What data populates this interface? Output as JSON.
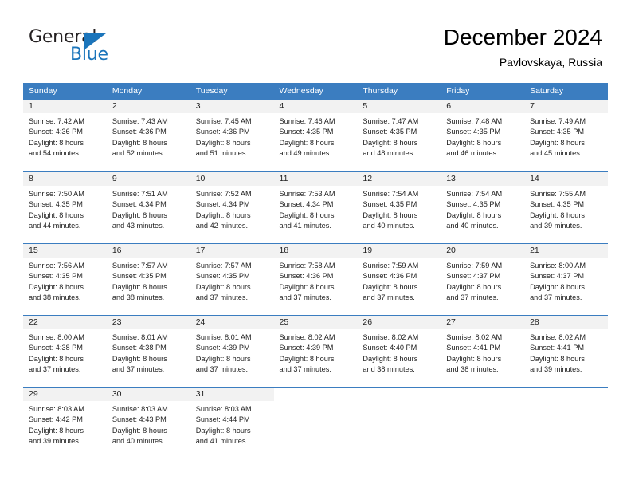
{
  "brand": {
    "name_part1": "General",
    "name_part2": "Blue",
    "accent_color": "#1b75bb",
    "triangle_icon": "triangle-icon"
  },
  "header": {
    "title": "December 2024",
    "subtitle": "Pavlovskaya, Russia"
  },
  "calendar": {
    "header_bg": "#3b7dc0",
    "daynum_strip_bg": "#f2f2f2",
    "weekdays": [
      "Sunday",
      "Monday",
      "Tuesday",
      "Wednesday",
      "Thursday",
      "Friday",
      "Saturday"
    ],
    "weeks": [
      [
        {
          "day": "1",
          "sunrise": "Sunrise: 7:42 AM",
          "sunset": "Sunset: 4:36 PM",
          "daylight_1": "Daylight: 8 hours",
          "daylight_2": "and 54 minutes."
        },
        {
          "day": "2",
          "sunrise": "Sunrise: 7:43 AM",
          "sunset": "Sunset: 4:36 PM",
          "daylight_1": "Daylight: 8 hours",
          "daylight_2": "and 52 minutes."
        },
        {
          "day": "3",
          "sunrise": "Sunrise: 7:45 AM",
          "sunset": "Sunset: 4:36 PM",
          "daylight_1": "Daylight: 8 hours",
          "daylight_2": "and 51 minutes."
        },
        {
          "day": "4",
          "sunrise": "Sunrise: 7:46 AM",
          "sunset": "Sunset: 4:35 PM",
          "daylight_1": "Daylight: 8 hours",
          "daylight_2": "and 49 minutes."
        },
        {
          "day": "5",
          "sunrise": "Sunrise: 7:47 AM",
          "sunset": "Sunset: 4:35 PM",
          "daylight_1": "Daylight: 8 hours",
          "daylight_2": "and 48 minutes."
        },
        {
          "day": "6",
          "sunrise": "Sunrise: 7:48 AM",
          "sunset": "Sunset: 4:35 PM",
          "daylight_1": "Daylight: 8 hours",
          "daylight_2": "and 46 minutes."
        },
        {
          "day": "7",
          "sunrise": "Sunrise: 7:49 AM",
          "sunset": "Sunset: 4:35 PM",
          "daylight_1": "Daylight: 8 hours",
          "daylight_2": "and 45 minutes."
        }
      ],
      [
        {
          "day": "8",
          "sunrise": "Sunrise: 7:50 AM",
          "sunset": "Sunset: 4:35 PM",
          "daylight_1": "Daylight: 8 hours",
          "daylight_2": "and 44 minutes."
        },
        {
          "day": "9",
          "sunrise": "Sunrise: 7:51 AM",
          "sunset": "Sunset: 4:34 PM",
          "daylight_1": "Daylight: 8 hours",
          "daylight_2": "and 43 minutes."
        },
        {
          "day": "10",
          "sunrise": "Sunrise: 7:52 AM",
          "sunset": "Sunset: 4:34 PM",
          "daylight_1": "Daylight: 8 hours",
          "daylight_2": "and 42 minutes."
        },
        {
          "day": "11",
          "sunrise": "Sunrise: 7:53 AM",
          "sunset": "Sunset: 4:34 PM",
          "daylight_1": "Daylight: 8 hours",
          "daylight_2": "and 41 minutes."
        },
        {
          "day": "12",
          "sunrise": "Sunrise: 7:54 AM",
          "sunset": "Sunset: 4:35 PM",
          "daylight_1": "Daylight: 8 hours",
          "daylight_2": "and 40 minutes."
        },
        {
          "day": "13",
          "sunrise": "Sunrise: 7:54 AM",
          "sunset": "Sunset: 4:35 PM",
          "daylight_1": "Daylight: 8 hours",
          "daylight_2": "and 40 minutes."
        },
        {
          "day": "14",
          "sunrise": "Sunrise: 7:55 AM",
          "sunset": "Sunset: 4:35 PM",
          "daylight_1": "Daylight: 8 hours",
          "daylight_2": "and 39 minutes."
        }
      ],
      [
        {
          "day": "15",
          "sunrise": "Sunrise: 7:56 AM",
          "sunset": "Sunset: 4:35 PM",
          "daylight_1": "Daylight: 8 hours",
          "daylight_2": "and 38 minutes."
        },
        {
          "day": "16",
          "sunrise": "Sunrise: 7:57 AM",
          "sunset": "Sunset: 4:35 PM",
          "daylight_1": "Daylight: 8 hours",
          "daylight_2": "and 38 minutes."
        },
        {
          "day": "17",
          "sunrise": "Sunrise: 7:57 AM",
          "sunset": "Sunset: 4:35 PM",
          "daylight_1": "Daylight: 8 hours",
          "daylight_2": "and 37 minutes."
        },
        {
          "day": "18",
          "sunrise": "Sunrise: 7:58 AM",
          "sunset": "Sunset: 4:36 PM",
          "daylight_1": "Daylight: 8 hours",
          "daylight_2": "and 37 minutes."
        },
        {
          "day": "19",
          "sunrise": "Sunrise: 7:59 AM",
          "sunset": "Sunset: 4:36 PM",
          "daylight_1": "Daylight: 8 hours",
          "daylight_2": "and 37 minutes."
        },
        {
          "day": "20",
          "sunrise": "Sunrise: 7:59 AM",
          "sunset": "Sunset: 4:37 PM",
          "daylight_1": "Daylight: 8 hours",
          "daylight_2": "and 37 minutes."
        },
        {
          "day": "21",
          "sunrise": "Sunrise: 8:00 AM",
          "sunset": "Sunset: 4:37 PM",
          "daylight_1": "Daylight: 8 hours",
          "daylight_2": "and 37 minutes."
        }
      ],
      [
        {
          "day": "22",
          "sunrise": "Sunrise: 8:00 AM",
          "sunset": "Sunset: 4:38 PM",
          "daylight_1": "Daylight: 8 hours",
          "daylight_2": "and 37 minutes."
        },
        {
          "day": "23",
          "sunrise": "Sunrise: 8:01 AM",
          "sunset": "Sunset: 4:38 PM",
          "daylight_1": "Daylight: 8 hours",
          "daylight_2": "and 37 minutes."
        },
        {
          "day": "24",
          "sunrise": "Sunrise: 8:01 AM",
          "sunset": "Sunset: 4:39 PM",
          "daylight_1": "Daylight: 8 hours",
          "daylight_2": "and 37 minutes."
        },
        {
          "day": "25",
          "sunrise": "Sunrise: 8:02 AM",
          "sunset": "Sunset: 4:39 PM",
          "daylight_1": "Daylight: 8 hours",
          "daylight_2": "and 37 minutes."
        },
        {
          "day": "26",
          "sunrise": "Sunrise: 8:02 AM",
          "sunset": "Sunset: 4:40 PM",
          "daylight_1": "Daylight: 8 hours",
          "daylight_2": "and 38 minutes."
        },
        {
          "day": "27",
          "sunrise": "Sunrise: 8:02 AM",
          "sunset": "Sunset: 4:41 PM",
          "daylight_1": "Daylight: 8 hours",
          "daylight_2": "and 38 minutes."
        },
        {
          "day": "28",
          "sunrise": "Sunrise: 8:02 AM",
          "sunset": "Sunset: 4:41 PM",
          "daylight_1": "Daylight: 8 hours",
          "daylight_2": "and 39 minutes."
        }
      ],
      [
        {
          "day": "29",
          "sunrise": "Sunrise: 8:03 AM",
          "sunset": "Sunset: 4:42 PM",
          "daylight_1": "Daylight: 8 hours",
          "daylight_2": "and 39 minutes."
        },
        {
          "day": "30",
          "sunrise": "Sunrise: 8:03 AM",
          "sunset": "Sunset: 4:43 PM",
          "daylight_1": "Daylight: 8 hours",
          "daylight_2": "and 40 minutes."
        },
        {
          "day": "31",
          "sunrise": "Sunrise: 8:03 AM",
          "sunset": "Sunset: 4:44 PM",
          "daylight_1": "Daylight: 8 hours",
          "daylight_2": "and 41 minutes."
        },
        {
          "day": "",
          "sunrise": "",
          "sunset": "",
          "daylight_1": "",
          "daylight_2": ""
        },
        {
          "day": "",
          "sunrise": "",
          "sunset": "",
          "daylight_1": "",
          "daylight_2": ""
        },
        {
          "day": "",
          "sunrise": "",
          "sunset": "",
          "daylight_1": "",
          "daylight_2": ""
        },
        {
          "day": "",
          "sunrise": "",
          "sunset": "",
          "daylight_1": "",
          "daylight_2": ""
        }
      ]
    ]
  }
}
